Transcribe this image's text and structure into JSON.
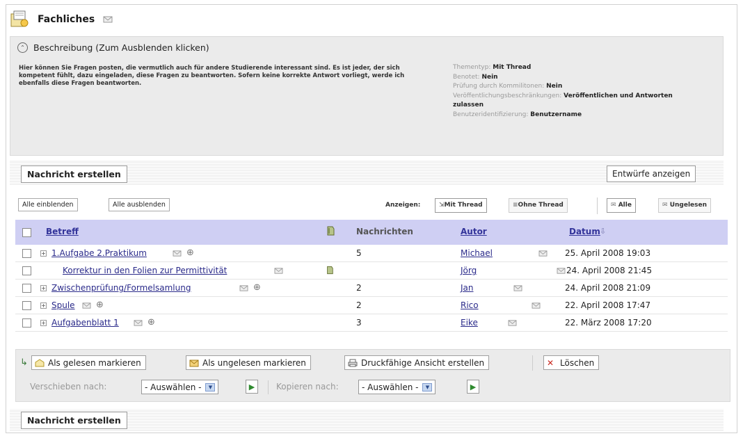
{
  "header": {
    "title": "Fachliches",
    "icon": "forum-folder-icon"
  },
  "description": {
    "toggle_label": "Beschreibung (Zum Ausblenden klicken)",
    "text": "Hier können Sie Fragen posten, die vermutlich auch für andere Studierende interessant sind. Es ist jeder, der sich kompetent fühlt, dazu eingeladen, diese Fragen zu beantworten. Sofern keine korrekte Antwort vorliegt, werde ich ebenfalls diese Fragen beantworten.",
    "meta": {
      "type_label": "Thementyp:",
      "type_value": "Mit Thread",
      "graded_label": "Benotet:",
      "graded_value": "Nein",
      "peer_label": "Prüfung durch Kommilitonen:",
      "peer_value": "Nein",
      "publish_label": "Veröffentlichungsbeschränkungen:",
      "publish_value": "Veröffentlichen und Antworten zulassen",
      "ident_label": "Benutzeridentifizierung:",
      "ident_value": "Benutzername"
    }
  },
  "toolbar": {
    "create_label": "Nachricht erstellen",
    "drafts_label": "Entwürfe anzeigen",
    "expand_all": "Alle einblenden",
    "collapse_all": "Alle ausblenden",
    "show_label": "Anzeigen:",
    "with_thread": "Mit Thread",
    "without_thread": "Ohne Thread",
    "all": "Alle",
    "unread": "Ungelesen"
  },
  "table": {
    "columns": {
      "subject": "Betreff",
      "messages": "Nachrichten",
      "author": "Autor",
      "date": "Datum"
    },
    "rows": [
      {
        "subject": "1.Aufgabe 2.Praktikum",
        "messages": "5",
        "author": "Michael",
        "date": "25. April 2008 19:03",
        "expandable": true
      },
      {
        "subject": "Korrektur in den Folien zur Permittivität",
        "messages": "",
        "author": "Jörg",
        "date": "24. April 2008 21:45",
        "expandable": false
      },
      {
        "subject": "Zwischenprüfung/Formelsamlung",
        "messages": "2",
        "author": "Jan",
        "date": "24. April 2008 21:09",
        "expandable": true
      },
      {
        "subject": "Spule",
        "messages": "2",
        "author": "Rico",
        "date": "22. April 2008 17:47",
        "expandable": true
      },
      {
        "subject": "Aufgabenblatt 1",
        "messages": "3",
        "author": "Eike",
        "date": "22. März 2008 17:20",
        "expandable": true
      }
    ]
  },
  "actions": {
    "mark_read": "Als gelesen markieren",
    "mark_unread": "Als ungelesen markieren",
    "print_view": "Druckfähige Ansicht erstellen",
    "delete": "Löschen",
    "move_label": "Verschieben nach:",
    "move_value": "- Auswählen -",
    "copy_label": "Kopieren nach:",
    "copy_value": "- Auswählen -"
  },
  "bottom": {
    "create_label": "Nachricht erstellen"
  },
  "colors": {
    "table_header": "#cfcff3",
    "link": "#2a2a8a",
    "panel": "#ebebeb"
  }
}
